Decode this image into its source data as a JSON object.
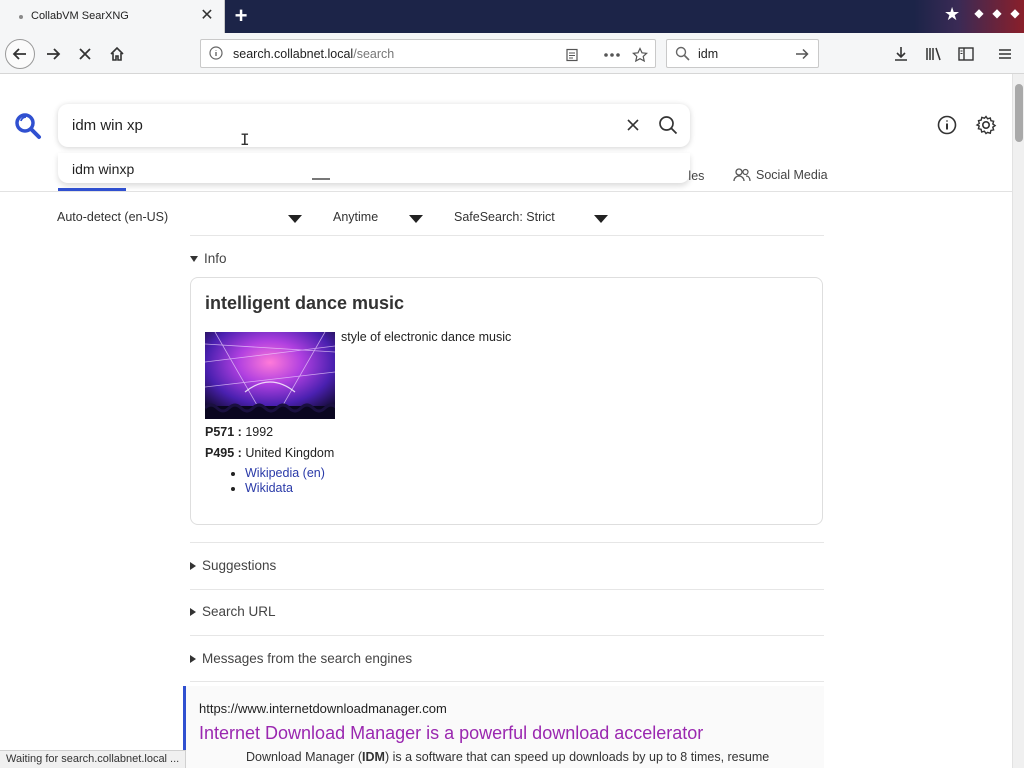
{
  "browser": {
    "tab_title": "CollabVM SearXNG",
    "url_host": "search.collabnet.local",
    "url_path": "/search",
    "url_prefix": "",
    "searchbar_text": "idm",
    "status_text": "Waiting for search.collabnet.local ..."
  },
  "search": {
    "query": "idm win xp",
    "autocomplete": [
      "idm winxp"
    ]
  },
  "categories": {
    "files_label": "Files",
    "social_label": "Social Media"
  },
  "filters": {
    "language": "Auto-detect (en-US)",
    "time_range": "Anytime",
    "safesearch": "SafeSearch: Strict"
  },
  "info_section": {
    "toggle_label": "Info",
    "title": "intelligent dance music",
    "description": "style of electronic dance music",
    "attributes": [
      {
        "key": "P571 :",
        "value": " 1992"
      },
      {
        "key": "P495 :",
        "value": " United Kingdom"
      }
    ],
    "links": [
      "Wikipedia (en)",
      "Wikidata"
    ]
  },
  "sections": {
    "suggestions": "Suggestions",
    "search_url": "Search URL",
    "engine_messages": "Messages from the search engines"
  },
  "result": {
    "url": "https://www.internetdownloadmanager.com",
    "title": "Internet Download Manager is a powerful download accelerator",
    "snippet_before": "Download Manager (",
    "snippet_bold": "IDM",
    "snippet_after": ") is a software that can speed up downloads by up to 8 times, resume"
  },
  "colors": {
    "accent": "#3050d0",
    "visited_link": "#9a27b0",
    "link": "#2a3aa8"
  }
}
